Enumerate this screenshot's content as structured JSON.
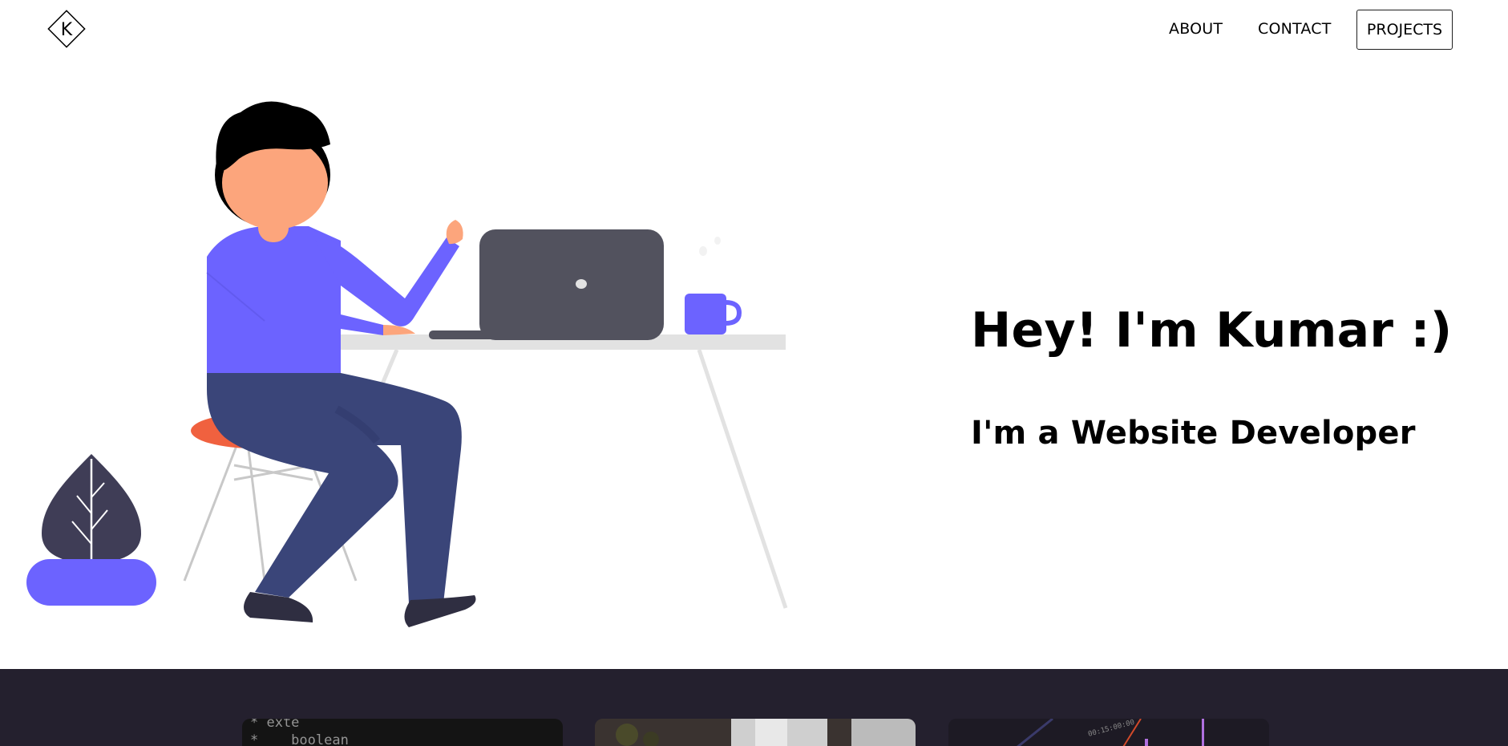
{
  "header": {
    "logo_letter": "K",
    "nav": {
      "about": "ABOUT",
      "contact": "CONTACT",
      "projects": "PROJECTS"
    }
  },
  "hero": {
    "title": "Hey! I'm Kumar :)",
    "subtitle": "I'm a Website Developer",
    "illustration": "person-at-desk-with-laptop"
  },
  "projects": {
    "cards": [
      {
        "name": "code-screenshot",
        "code_lines": "* exte\n*    boolean"
      },
      {
        "name": "desk-photo"
      },
      {
        "name": "video-editor-screenshot",
        "timestamp": "00:15:00:00"
      }
    ]
  },
  "colors": {
    "accent": "#6c63ff",
    "dark_section": "#24202e",
    "pants": "#3a4579",
    "skin": "#fca57c",
    "stool": "#f0613f",
    "laptop": "#52525e",
    "plant_leaf": "#3f3d56"
  }
}
